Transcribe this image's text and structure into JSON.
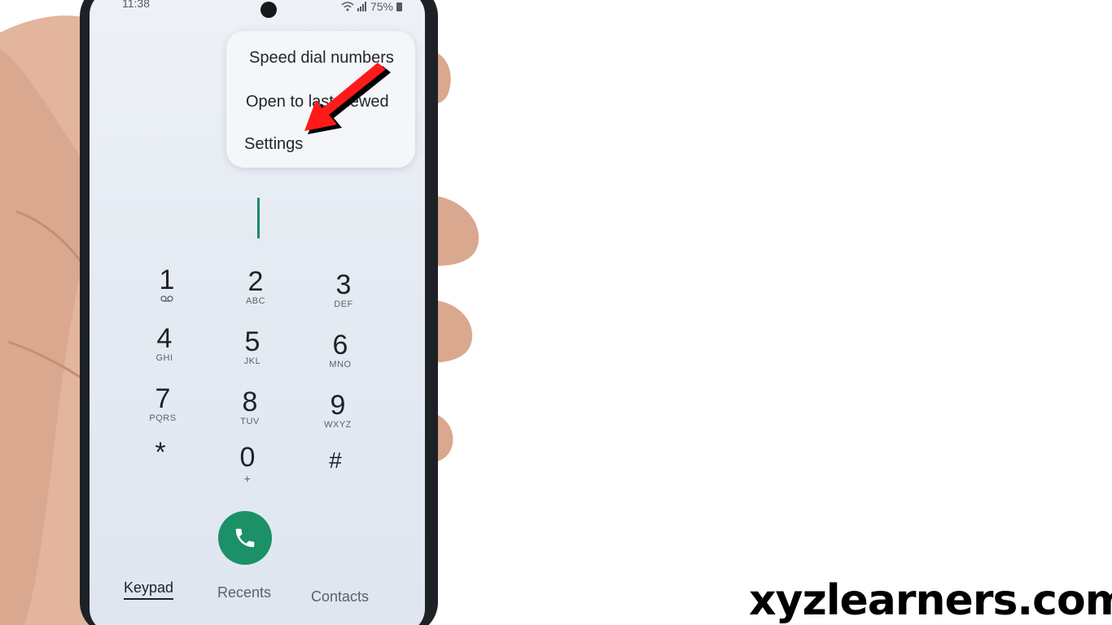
{
  "status_bar": {
    "time": "11:38",
    "battery": "75%"
  },
  "overflow_menu": {
    "items": [
      {
        "label": "Speed dial numbers"
      },
      {
        "label": "Open to last viewed"
      },
      {
        "label": "Settings"
      }
    ]
  },
  "keypad": {
    "keys": [
      {
        "digit": "1",
        "letters": ""
      },
      {
        "digit": "2",
        "letters": "ABC"
      },
      {
        "digit": "3",
        "letters": "DEF"
      },
      {
        "digit": "4",
        "letters": "GHI"
      },
      {
        "digit": "5",
        "letters": "JKL"
      },
      {
        "digit": "6",
        "letters": "MNO"
      },
      {
        "digit": "7",
        "letters": "PQRS"
      },
      {
        "digit": "8",
        "letters": "TUV"
      },
      {
        "digit": "9",
        "letters": "WXYZ"
      },
      {
        "digit": "*",
        "letters": ""
      },
      {
        "digit": "0",
        "letters": "+"
      },
      {
        "digit": "#",
        "letters": ""
      }
    ]
  },
  "bottom_tabs": {
    "items": [
      {
        "label": "Keypad",
        "active": true
      },
      {
        "label": "Recents",
        "active": false
      },
      {
        "label": "Contacts",
        "active": false
      }
    ]
  },
  "watermark": {
    "text": "xyzlearners.com"
  },
  "colors": {
    "call_button": "#1c9066",
    "annotation_arrow": "#ff1a1a",
    "cursor": "#1a8a6a"
  },
  "icons": {
    "voicemail": "voicemail-icon",
    "call": "phone-icon",
    "annotation": "red-arrow-icon"
  }
}
